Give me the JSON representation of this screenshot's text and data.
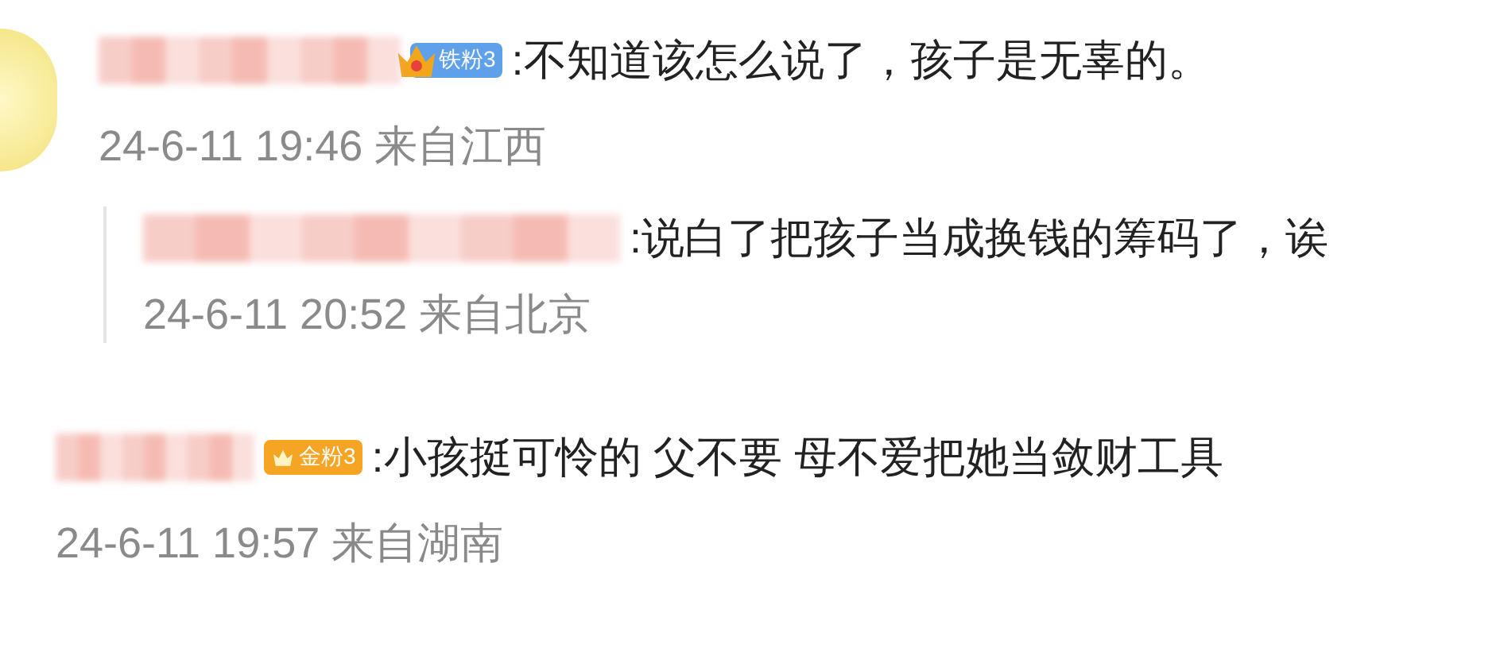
{
  "comments": [
    {
      "indent": false,
      "avatar": true,
      "badge": {
        "label": "铁粉3",
        "kind": "iron"
      },
      "text": ":不知道该怎么说了，孩子是无辜的。",
      "meta": "24-6-11 19:46 来自江西"
    },
    {
      "indent": true,
      "avatar": false,
      "text": ":说白了把孩子当成换钱的筹码了，诶",
      "meta": "24-6-11 20:52 来自北京"
    },
    {
      "indent": false,
      "avatar": false,
      "badge": {
        "label": "金粉3",
        "kind": "gold"
      },
      "text": ":小孩挺可怜的 父不要 母不爱把她当敛财工具",
      "meta": "24-6-11 19:57 来自湖南"
    }
  ]
}
